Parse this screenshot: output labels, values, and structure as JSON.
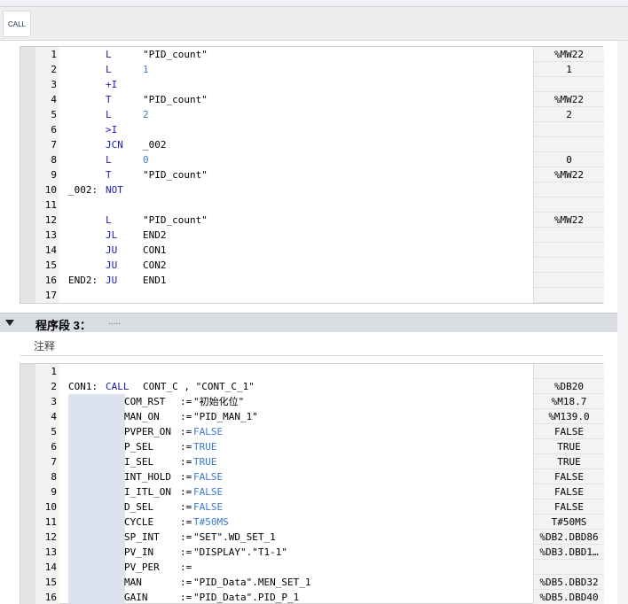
{
  "toolbar": {
    "call_label": "CALL"
  },
  "network2": {
    "lines": [
      {
        "n": "1",
        "label": "",
        "op": "L",
        "opnd": "\"PID_count\"",
        "opnd_type": "str",
        "val": "%MW22"
      },
      {
        "n": "2",
        "label": "",
        "op": "L",
        "opnd": "1",
        "opnd_type": "num",
        "val": "1"
      },
      {
        "n": "3",
        "label": "",
        "op": "+I",
        "opnd": "",
        "opnd_type": "str",
        "val": ""
      },
      {
        "n": "4",
        "label": "",
        "op": "T",
        "opnd": "\"PID_count\"",
        "opnd_type": "str",
        "val": "%MW22"
      },
      {
        "n": "5",
        "label": "",
        "op": "L",
        "opnd": "2",
        "opnd_type": "num",
        "val": "2"
      },
      {
        "n": "6",
        "label": "",
        "op": ">I",
        "opnd": "",
        "opnd_type": "str",
        "val": ""
      },
      {
        "n": "7",
        "label": "",
        "op": "JCN",
        "opnd": "_002",
        "opnd_type": "str",
        "val": ""
      },
      {
        "n": "8",
        "label": "",
        "op": "L",
        "opnd": "0",
        "opnd_type": "num",
        "val": "0"
      },
      {
        "n": "9",
        "label": "",
        "op": "T",
        "opnd": "\"PID_count\"",
        "opnd_type": "str",
        "val": "%MW22"
      },
      {
        "n": "10",
        "label": "_002:",
        "op": "NOT",
        "opnd": "",
        "opnd_type": "str",
        "val": ""
      },
      {
        "n": "11",
        "label": "",
        "op": "",
        "opnd": "",
        "opnd_type": "str",
        "val": ""
      },
      {
        "n": "12",
        "label": "",
        "op": "L",
        "opnd": "\"PID_count\"",
        "opnd_type": "str",
        "val": "%MW22"
      },
      {
        "n": "13",
        "label": "",
        "op": "JL",
        "opnd": "END2",
        "opnd_type": "str",
        "val": ""
      },
      {
        "n": "14",
        "label": "",
        "op": "JU",
        "opnd": "CON1",
        "opnd_type": "str",
        "val": ""
      },
      {
        "n": "15",
        "label": "",
        "op": "JU",
        "opnd": "CON2",
        "opnd_type": "str",
        "val": ""
      },
      {
        "n": "16",
        "label": "END2:",
        "op": "JU",
        "opnd": "END1",
        "opnd_type": "str",
        "val": ""
      },
      {
        "n": "17",
        "label": "",
        "op": "",
        "opnd": "",
        "opnd_type": "str",
        "val": ""
      }
    ]
  },
  "network3": {
    "title": "程序段 3：",
    "dots": ".....",
    "comment_label": "注释",
    "call_line": {
      "n": "2",
      "label": "CON1:",
      "kw": "CALL",
      "rest": "CONT_C , \"CONT_C_1\"",
      "val": "%DB20"
    },
    "empty_line": {
      "n": "1"
    },
    "params": [
      {
        "n": "3",
        "name": "COM_RST  ",
        "assign": ":=",
        "value": "\"初始化位\"",
        "value_type": "str",
        "val": "%M18.7"
      },
      {
        "n": "4",
        "name": "MAN_ON   ",
        "assign": ":=",
        "value": "\"PID_MAN_1\"",
        "value_type": "str",
        "val": "%M139.0"
      },
      {
        "n": "5",
        "name": "PVPER_ON ",
        "assign": ":=",
        "value": "FALSE",
        "value_type": "bool",
        "val": "FALSE"
      },
      {
        "n": "6",
        "name": "P_SEL    ",
        "assign": ":=",
        "value": "TRUE",
        "value_type": "bool",
        "val": "TRUE"
      },
      {
        "n": "7",
        "name": "I_SEL    ",
        "assign": ":=",
        "value": "TRUE",
        "value_type": "bool",
        "val": "TRUE"
      },
      {
        "n": "8",
        "name": "INT_HOLD ",
        "assign": ":=",
        "value": "FALSE",
        "value_type": "bool",
        "val": "FALSE"
      },
      {
        "n": "9",
        "name": "I_ITL_ON ",
        "assign": ":=",
        "value": "FALSE",
        "value_type": "bool",
        "val": "FALSE"
      },
      {
        "n": "10",
        "name": "D_SEL    ",
        "assign": ":=",
        "value": "FALSE",
        "value_type": "bool",
        "val": "FALSE"
      },
      {
        "n": "11",
        "name": "CYCLE    ",
        "assign": ":=",
        "value": "T#50MS",
        "value_type": "bool",
        "val": "T#50MS"
      },
      {
        "n": "12",
        "name": "SP_INT   ",
        "assign": ":=",
        "value": "\"SET\".WD_SET_1",
        "value_type": "str",
        "val": "%DB2.DBD86"
      },
      {
        "n": "13",
        "name": "PV_IN    ",
        "assign": ":=",
        "value": "\"DISPLAY\".\"T1-1\"",
        "value_type": "str",
        "val": "%DB3.DBD1…"
      },
      {
        "n": "14",
        "name": "PV_PER   ",
        "assign": ":=",
        "value": "",
        "value_type": "str",
        "val": ""
      },
      {
        "n": "15",
        "name": "MAN      ",
        "assign": ":=",
        "value": "\"PID_Data\".MEN_SET_1",
        "value_type": "str",
        "val": "%DB5.DBD32"
      },
      {
        "n": "16",
        "name": "GAIN     ",
        "assign": ":=",
        "value": "\"PID_Data\".PID_P_1",
        "value_type": "str",
        "val": "%DB5.DBD40"
      }
    ]
  }
}
